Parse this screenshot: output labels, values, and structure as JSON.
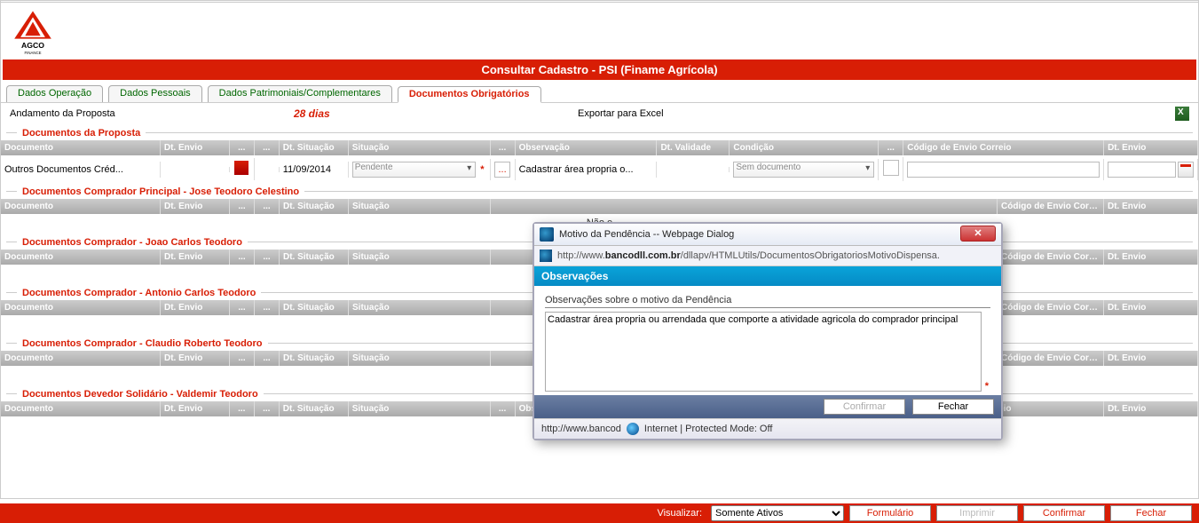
{
  "header": {
    "title": "Consultar Cadastro - PSI (Finame Agrícola)"
  },
  "tabs": {
    "operacao": "Dados Operação",
    "pessoais": "Dados Pessoais",
    "patrimoniais": "Dados Patrimoniais/Complementares",
    "docs": "Documentos Obrigatórios"
  },
  "subheader": {
    "andamento": "Andamento da Proposta",
    "dias": "28 dias",
    "exportar": "Exportar para Excel"
  },
  "sections": {
    "proposta": "Documentos da Proposta",
    "comprador_principal": "Documentos Comprador Principal - Jose Teodoro Celestino",
    "comprador1": "Documentos Comprador - Joao Carlos Teodoro",
    "comprador2": "Documentos Comprador - Antonio Carlos Teodoro",
    "comprador3": "Documentos Comprador - Claudio Roberto Teodoro",
    "devedor": "Documentos Devedor Solidário - Valdemir Teodoro",
    "nao_existe": "Não e"
  },
  "grid_headers": {
    "documento": "Documento",
    "dt_envio": "Dt. Envio",
    "ellipsis": "...",
    "dt_situacao": "Dt. Situação",
    "situacao": "Situação",
    "observacao": "Observação",
    "dt_validade": "Dt. Validade",
    "condicao": "Condição",
    "codigo_envio": "Código de Envio Correio",
    "dt_envio2": "Dt. Envio"
  },
  "row1": {
    "documento": "Outros Documentos Créd...",
    "dt_situacao": "11/09/2014",
    "situacao": "Pendente",
    "observacao": "Cadastrar área propria o...",
    "condicao": "Sem documento"
  },
  "dialog": {
    "title": "Motivo da Pendência -- Webpage Dialog",
    "url_prefix": "http://www.",
    "url_host": "bancodll.com.br",
    "url_path": "/dllapv/HTMLUtils/DocumentosObrigatoriosMotivoDispensa.",
    "obs_header": "Observações",
    "obs_label": "Observações sobre o motivo da Pendência",
    "obs_text": "Cadastrar área propria ou arrendada que comporte a atividade agricola do comprador principal",
    "confirmar": "Confirmar",
    "fechar": "Fechar",
    "status_host": "http://www.bancod",
    "status_zone": "Internet | Protected Mode: Off"
  },
  "footer": {
    "visualizar": "Visualizar:",
    "somente_ativos": "Somente Ativos",
    "formulario": "Formulário",
    "imprimir": "Imprimir",
    "confirmar": "Confirmar",
    "fechar": "Fechar"
  }
}
